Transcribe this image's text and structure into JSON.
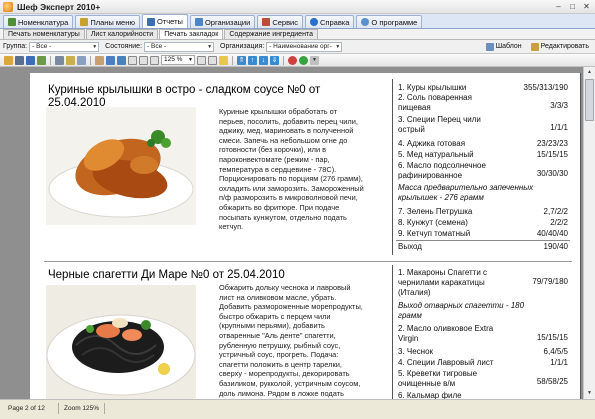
{
  "window": {
    "title": "Шеф Эксперт 2010+",
    "controls": [
      "–",
      "□",
      "✕"
    ]
  },
  "main_tabs": [
    {
      "label": "Номенклатура",
      "color": "#4f8f3a"
    },
    {
      "label": "Планы меню",
      "color": "#c9a12a"
    },
    {
      "label": "Отчеты",
      "color": "#3a6fb6",
      "active": true
    },
    {
      "label": "Организации",
      "color": "#4a86c8"
    },
    {
      "label": "Сервис",
      "color": "#c04a3a"
    },
    {
      "label": "Справка",
      "color": "#2a6fc9"
    },
    {
      "label": "О программе",
      "color": "#5a8fd0"
    }
  ],
  "sub_tabs": [
    {
      "label": "Печать номенклатуры"
    },
    {
      "label": "Лист калорийности"
    },
    {
      "label": "Печать закладок",
      "active": true
    },
    {
      "label": "Содержание ингредиента"
    }
  ],
  "filters": {
    "group_label": "Группа:",
    "group_value": "- Все -",
    "state_label": "Состояние:",
    "state_value": "- Все -",
    "org_label": "Организация:",
    "org_value": "- Наименование орг-"
  },
  "buttons": {
    "template": "Шаблон",
    "edit": "Редактировать"
  },
  "zoom": "125 %",
  "recipes": [
    {
      "title_line1": "Куриные крылышки в остро - сладком соусе №0 от",
      "title_line2": "25.04.2010",
      "description": [
        "Куриные крылышки обработать от",
        "перьев, посолить, добавить перец чили,",
        "аджику, мед, мариновать в полученной",
        "смеси. Запечь на небольшом огне до",
        "готовности (без корочки), или в",
        "пароконвектомате (режим - пар,",
        "температура в сердцевине - 78С).",
        "Порционировать по порциям (276 грамм),",
        "охладить или заморозить. Замороженный",
        "п/ф разморозить в микроволновой печи,",
        "обжарить во фритюре. При подаче",
        "посыпать кунжутом, отдельно подать",
        "кетчуп."
      ],
      "ingredients": [
        {
          "name": "1. Куры крылышки",
          "qty": "355/313/190"
        },
        {
          "name": "2. Соль поваренная",
          "name2": "пищевая",
          "qty": "3/3/3"
        },
        {
          "name": "3. Специи Перец чили",
          "name2": "острый",
          "qty": "1/1/1"
        },
        {
          "name": "4. Аджика готовая",
          "qty": "23/23/23"
        },
        {
          "name": "5. Мед натуральный",
          "qty": "15/15/15"
        },
        {
          "name": "6. Масло подсолнечное",
          "name2": "рафинированное",
          "qty": "30/30/30"
        },
        {
          "name": "Масса предварительно запеченных",
          "name2": "крылышек - 276 грамм",
          "qty": "",
          "italic": true
        },
        {
          "name": "7. Зелень Петрушка",
          "qty": "2,7/2/2"
        },
        {
          "name": "8. Кунжут (семена)",
          "qty": "2/2/2"
        },
        {
          "name": "9. Кетчуп томатный",
          "qty": "40/40/40"
        }
      ],
      "yield_label": "Выход",
      "yield_value": "190/40"
    },
    {
      "title_line1": "Черные спагетти Ди Маре №0 от 25.04.2010",
      "description": [
        "Обжарить дольку чеснока и лавровый",
        "лист на оливковом масле, убрать.",
        "Добавить размороженные морепродукты,",
        "быстро обжарить с перцем чили",
        "(крупными перьями), добавить",
        "отваренные \"Аль денте\" спагетти,",
        "рубленную петрушку, рыбный соус,",
        "устричный соус, прогреть. Подача:",
        "спагетти положить в центр тарелки,",
        "сверху - морепродукты, декорировать",
        "базиликом, рукколой, устричным соусом,",
        "доль лимона. Рядом в ложке подать"
      ],
      "ingredients": [
        {
          "name": "1. Макароны Спагетти с",
          "name2": "чернилами каракатицы",
          "name3": "(Италия)",
          "qty": "79/79/180"
        },
        {
          "name": "Выход отварных спагетти - 180",
          "name2": "грамм",
          "qty": "",
          "italic": true
        },
        {
          "name": "2. Масло оливковое Extra",
          "name2": "Virgin",
          "qty": "15/15/15"
        },
        {
          "name": "3. Чеснок",
          "qty": "6,4/5/5"
        },
        {
          "name": "4. Специи Лавровый лист",
          "qty": "1/1/1"
        },
        {
          "name": "5. Креветки тигровые",
          "name2": "очищенные в/м",
          "qty": "58/58/25"
        },
        {
          "name": "6. Кальмар филе",
          "qty": ""
        }
      ]
    }
  ],
  "status": {
    "page": "Page 2 of 12",
    "zoom": "Zoom 125%"
  }
}
